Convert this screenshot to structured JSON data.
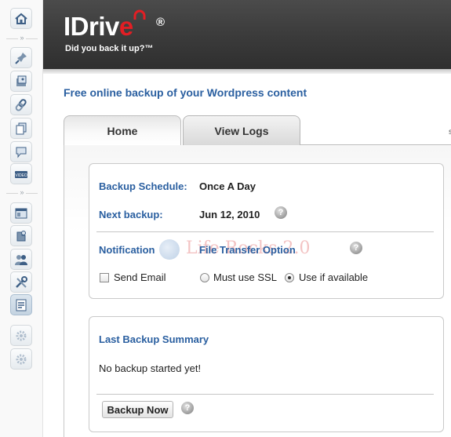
{
  "header": {
    "logo_text_main": "IDriv",
    "logo_text_e": "e",
    "registered_mark": "®",
    "tagline": "Did you back it up?™"
  },
  "sidebar": {
    "icons": [
      "dashboard-icon",
      "pin-icon",
      "media-icon",
      "link-icon",
      "pages-icon",
      "comments-icon",
      "video-icon",
      "appearance-icon",
      "plugins-icon",
      "users-icon",
      "tools-icon",
      "settings-icon",
      "gear-icon",
      "gear-icon"
    ],
    "separator_glyph": "»"
  },
  "main": {
    "title": "Free online backup of your Wordpress content",
    "tabs": [
      {
        "label": "Home",
        "active": true
      },
      {
        "label": "View Logs",
        "active": false
      }
    ],
    "tab_overflow_glyph": "s"
  },
  "schedule": {
    "backup_schedule_label": "Backup Schedule:",
    "backup_schedule_value": "Once A Day",
    "next_backup_label": "Next backup:",
    "next_backup_value": "Jun 12, 2010",
    "notification_label": "Notification",
    "file_transfer_label": "File Transfer Option",
    "send_email_label": "Send Email",
    "send_email_checked": false,
    "ssl_options": [
      {
        "label": "Must use SSL",
        "checked": false
      },
      {
        "label": "Use if available",
        "checked": true
      }
    ]
  },
  "summary": {
    "title": "Last Backup Summary",
    "status_text": "No backup started yet!",
    "backup_button_label": "Backup Now"
  },
  "help_glyph": "?",
  "watermark_text": "Life Rocks 2.0",
  "colors": {
    "accent_blue": "#2a5fa0",
    "header_dark": "#3a3a3a",
    "logo_red": "#e31e24"
  }
}
